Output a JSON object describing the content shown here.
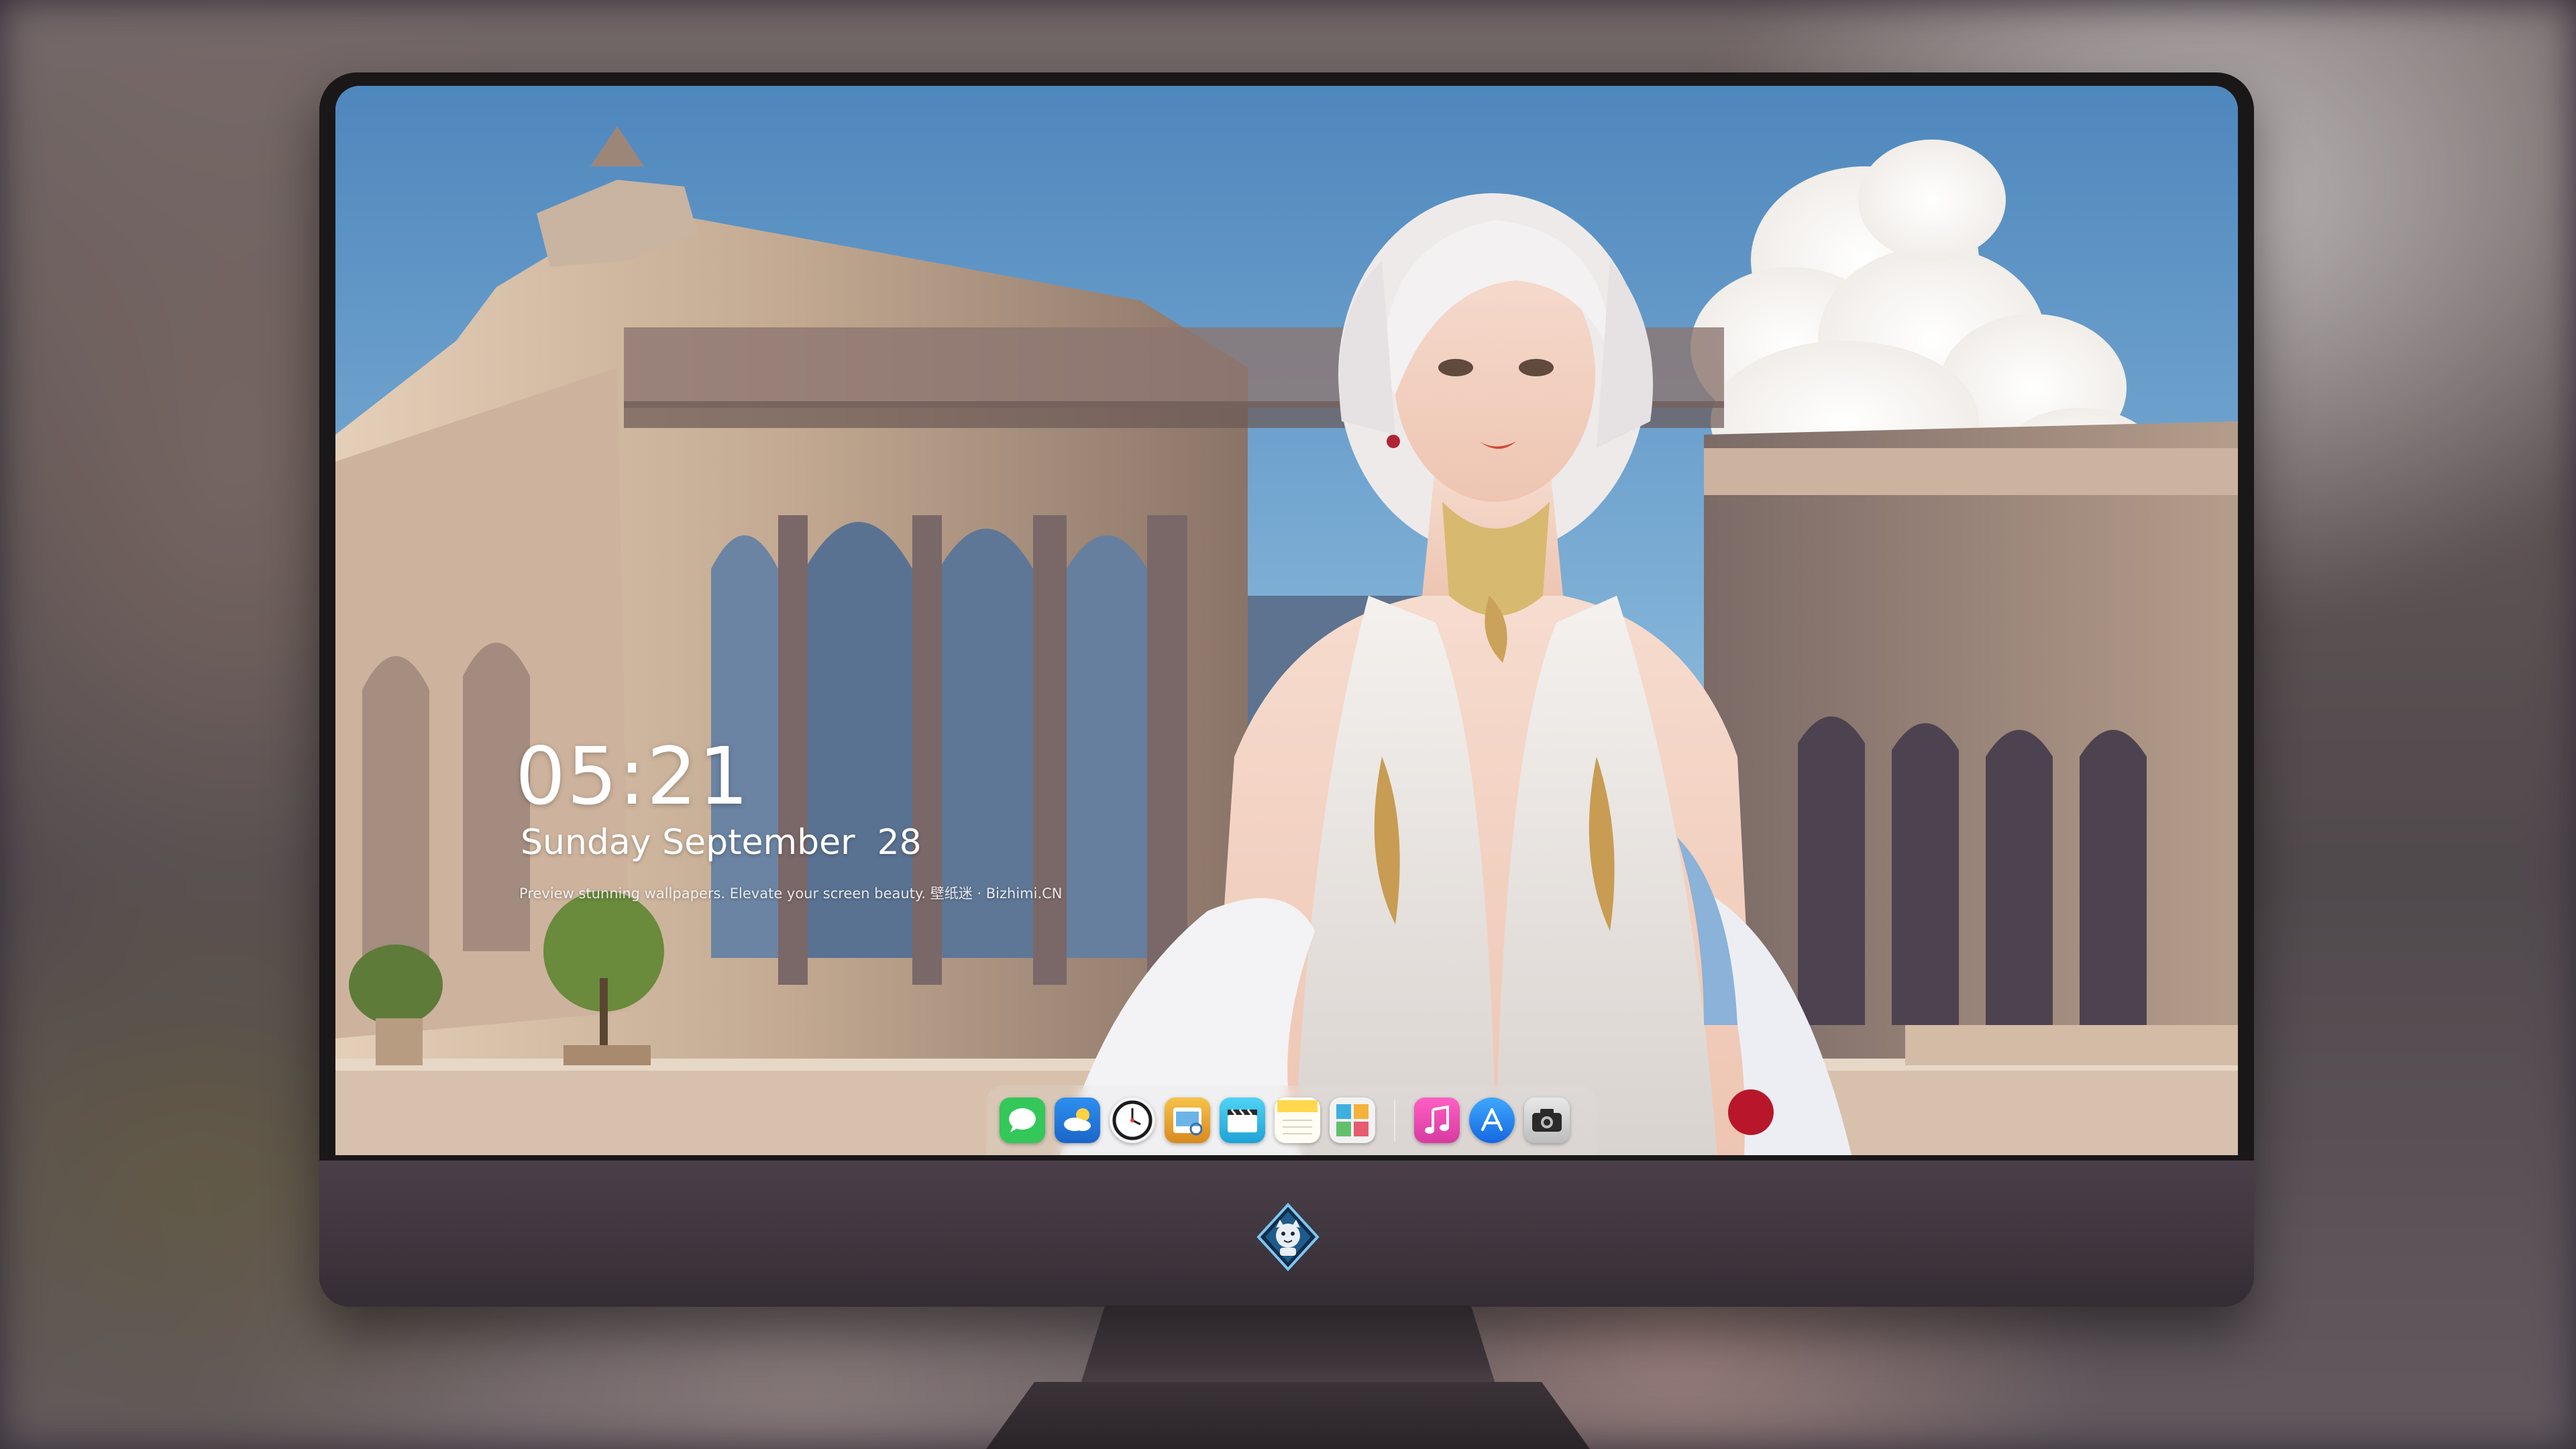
{
  "lockscreen": {
    "time": "05:21",
    "date": "Sunday September  28",
    "tagline": "Preview stunning wallpapers. Elevate your screen beauty. 壁纸迷 · Bizhimi.CN"
  },
  "dock": {
    "apps": [
      {
        "name": "Messages",
        "icon": "messages-icon",
        "color": "#34c759"
      },
      {
        "name": "Weather",
        "icon": "weather-icon",
        "color": "#1e88e5"
      },
      {
        "name": "Clock",
        "icon": "clock-icon",
        "color": "#1c1c1e"
      },
      {
        "name": "Preview",
        "icon": "preview-icon",
        "color": "#e8a534"
      },
      {
        "name": "Clips",
        "icon": "clips-icon",
        "color": "#35b8e8"
      },
      {
        "name": "Notes",
        "icon": "notes-icon",
        "color": "#ffd84f"
      },
      {
        "name": "Photo Booth",
        "icon": "photo-booth-icon",
        "color": "#3db0e0"
      },
      {
        "name": "Music",
        "icon": "music-icon",
        "color": "#f04ab8"
      },
      {
        "name": "App Store",
        "icon": "app-store-icon",
        "color": "#1e90ff"
      },
      {
        "name": "Camera",
        "icon": "camera-icon",
        "color": "#d9d9d9"
      }
    ]
  },
  "colors": {
    "bezel": "#1a1719",
    "chin": "#433a42",
    "sky": "#6b9ec8",
    "stone": "#b9a08e"
  }
}
